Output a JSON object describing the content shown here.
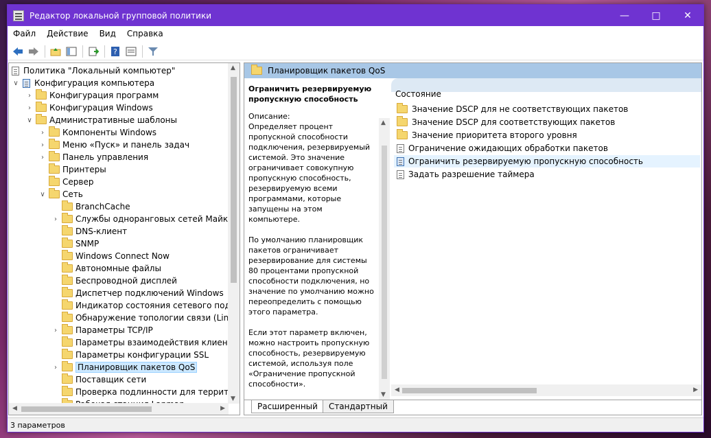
{
  "window": {
    "title": "Редактор локальной групповой политики"
  },
  "menu": [
    "Файл",
    "Действие",
    "Вид",
    "Справка"
  ],
  "tree": {
    "root": "Политика \"Локальный компьютер\"",
    "items": [
      {
        "label": "Конфигурация компьютера",
        "level": 1,
        "exp": "v"
      },
      {
        "label": "Конфигурация программ",
        "level": 2,
        "exp": ">"
      },
      {
        "label": "Конфигурация Windows",
        "level": 2,
        "exp": ">"
      },
      {
        "label": "Административные шаблоны",
        "level": 2,
        "exp": "v"
      },
      {
        "label": "Компоненты Windows",
        "level": 3,
        "exp": ">"
      },
      {
        "label": "Меню «Пуск» и панель задач",
        "level": 3,
        "exp": ">"
      },
      {
        "label": "Панель управления",
        "level": 3,
        "exp": ">"
      },
      {
        "label": "Принтеры",
        "level": 3,
        "exp": ""
      },
      {
        "label": "Сервер",
        "level": 3,
        "exp": ""
      },
      {
        "label": "Сеть",
        "level": 3,
        "exp": "v"
      },
      {
        "label": "BranchCache",
        "level": 4,
        "exp": ""
      },
      {
        "label": "Службы одноранговых сетей Майкрософт",
        "level": 4,
        "exp": ">"
      },
      {
        "label": "DNS-клиент",
        "level": 4,
        "exp": ""
      },
      {
        "label": "SNMP",
        "level": 4,
        "exp": ""
      },
      {
        "label": "Windows Connect Now",
        "level": 4,
        "exp": ""
      },
      {
        "label": "Автономные файлы",
        "level": 4,
        "exp": ""
      },
      {
        "label": "Беспроводной дисплей",
        "level": 4,
        "exp": ""
      },
      {
        "label": "Диспетчер подключений Windows",
        "level": 4,
        "exp": ""
      },
      {
        "label": "Индикатор состояния сетевого подключения",
        "level": 4,
        "exp": ""
      },
      {
        "label": "Обнаружение топологии связи (Link-Layer)",
        "level": 4,
        "exp": ""
      },
      {
        "label": "Параметры TCP/IP",
        "level": 4,
        "exp": ">"
      },
      {
        "label": "Параметры взаимодействия клиента Direct",
        "level": 4,
        "exp": ""
      },
      {
        "label": "Параметры конфигурации SSL",
        "level": 4,
        "exp": ""
      },
      {
        "label": "Планировщик пакетов QoS",
        "level": 4,
        "exp": ">",
        "selected": true
      },
      {
        "label": "Поставщик сети",
        "level": 4,
        "exp": ""
      },
      {
        "label": "Проверка подлинности для территории",
        "level": 4,
        "exp": ""
      },
      {
        "label": "Рабочая станция Lanman",
        "level": 4,
        "exp": ""
      }
    ]
  },
  "right": {
    "header": "Планировщик пакетов QoS",
    "desc_title": "Ограничить резервируемую пропускную способность",
    "desc_body": "Описание:\nОпределяет процент пропускной способности подключения, резервируемый системой. Это значение ограничивает совокупную пропускную способность, резервируемую всеми программами, которые запущены на этом компьютере.\n\nПо умолчанию планировщик пакетов ограничивает резервирование для системы 80 процентами пропускной способности подключения, но значение по умолчанию можно переопределить с помощью этого параметра.\n\nЕсли этот параметр включен, можно настроить пропускную способность, резервируемую системой, используя поле «Ограничение пропускной способности».\n\nЕсли этот параметр отключен",
    "column": "Состояние",
    "items": [
      {
        "label": "Значение DSCP для не соответствующих пакетов",
        "icon": "folder"
      },
      {
        "label": "Значение DSCP для соответствующих пакетов",
        "icon": "folder"
      },
      {
        "label": "Значение приоритета второго уровня",
        "icon": "folder"
      },
      {
        "label": "Ограничение ожидающих обработки пакетов",
        "icon": "doc"
      },
      {
        "label": "Ограничить резервируемую пропускную способность",
        "icon": "doc-blue",
        "selected": true
      },
      {
        "label": "Задать разрешение таймера",
        "icon": "doc"
      }
    ],
    "tabs": [
      "Расширенный",
      "Стандартный"
    ]
  },
  "status": "3 параметров"
}
